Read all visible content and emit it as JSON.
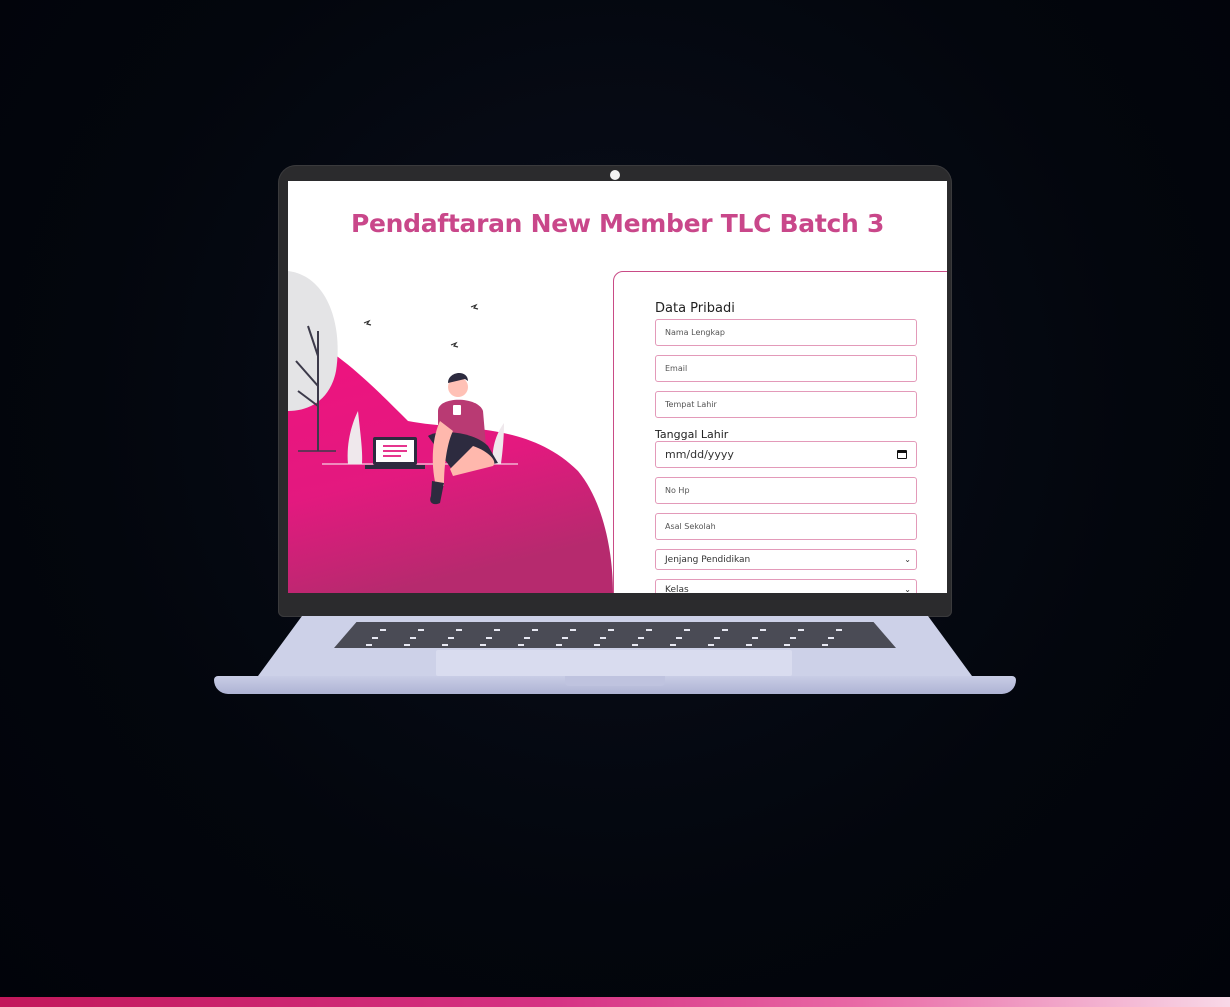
{
  "page": {
    "title": "Pendaftaran New Member TLC Batch 3"
  },
  "form": {
    "section_title": "Data Pribadi",
    "fields": {
      "nama": "Nama Lengkap",
      "email": "Email",
      "tempat_lahir": "Tempat Lahir",
      "tanggal_label": "Tanggal Lahir",
      "tanggal_placeholder": "mm/dd/yyyy",
      "no_hp": "No Hp",
      "asal_sekolah": "Asal Sekolah",
      "jenjang": "Jenjang Pendidikan",
      "kelas": "Kelas"
    }
  },
  "icons": {
    "calendar": "calendar-icon",
    "chevron": "chevron-down-icon"
  },
  "colors": {
    "accent": "#c9478a",
    "pink": "#e8137f",
    "border": "#e39ab9"
  }
}
